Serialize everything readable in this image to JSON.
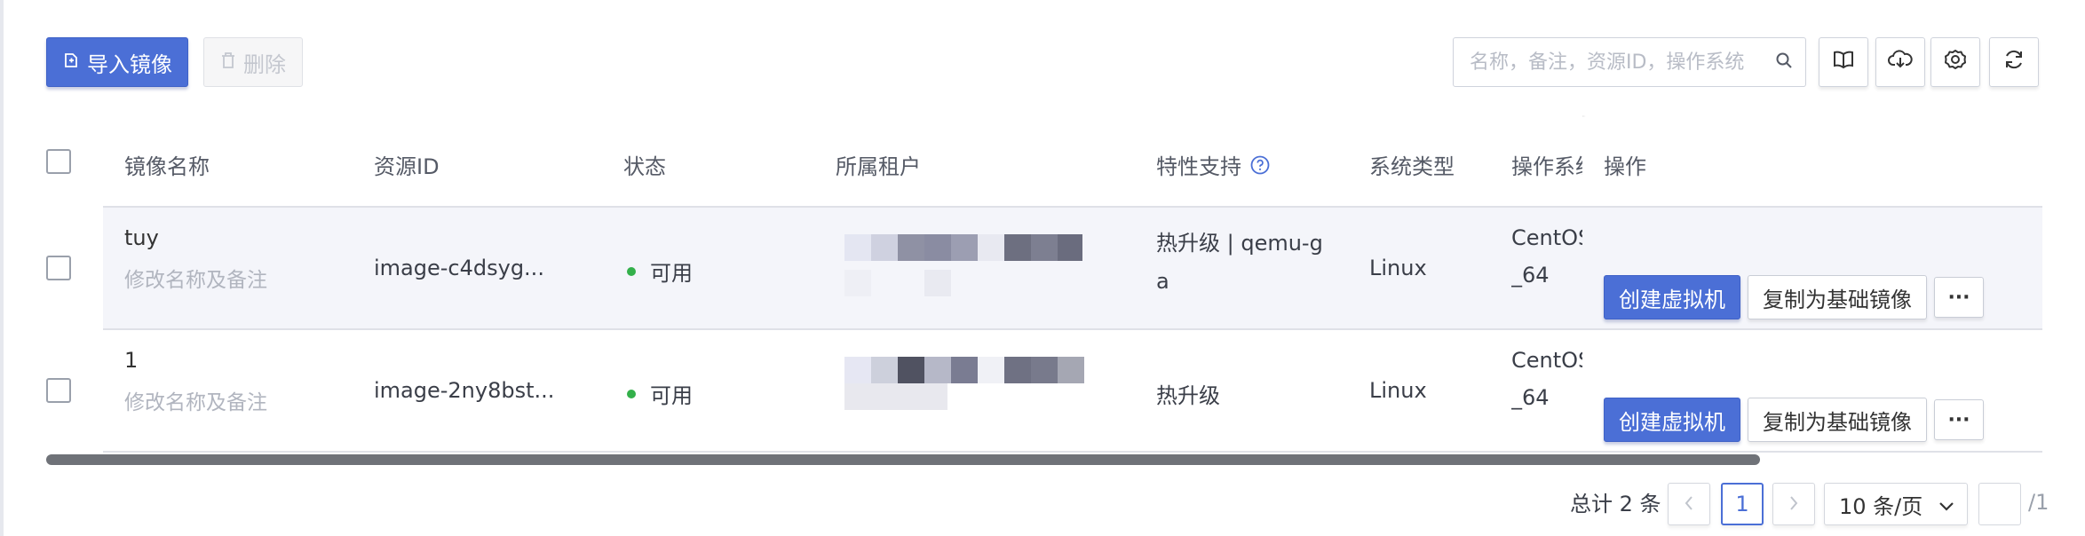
{
  "toolbar": {
    "import_label": "导入镜像",
    "delete_label": "删除",
    "search_placeholder": "名称，备注，资源ID，操作系统"
  },
  "table": {
    "headers": {
      "name": "镜像名称",
      "resource_id": "资源ID",
      "status": "状态",
      "tenant": "所属租户",
      "features": "特性支持",
      "system_type": "系统类型",
      "os": "操作系统",
      "actions": "操作"
    },
    "rows": [
      {
        "name": "tuy",
        "note_action": "修改名称及备注",
        "resource_id": "image-c4dsyg...",
        "status": "可用",
        "features_line1": "热升级 | qemu-g",
        "features_line2": "a",
        "system_type": "Linux",
        "os_line1": "CentOS",
        "os_line2": "_64",
        "create_vm": "创建虚拟机",
        "copy_base": "复制为基础镜像",
        "more": "···"
      },
      {
        "name": "1",
        "note_action": "修改名称及备注",
        "resource_id": "image-2ny8bst...",
        "status": "可用",
        "features_line1": "热升级",
        "features_line2": "",
        "system_type": "Linux",
        "os_line1": "CentOS",
        "os_line2": "_64",
        "create_vm": "创建虚拟机",
        "copy_base": "复制为基础镜像",
        "more": "···"
      }
    ]
  },
  "pagination": {
    "total": "总计 2 条",
    "current_page": "1",
    "page_size": "10 条/页",
    "page_suffix": "/1"
  },
  "colors": {
    "primary": "#4b6fd6",
    "status_available": "#33b04a",
    "row_background": "#f4f5fa"
  },
  "icons": {
    "import": "import-icon",
    "delete": "trash-icon",
    "search": "search-icon",
    "docs": "book-icon",
    "download": "cloud-download-icon",
    "settings": "gear-icon",
    "refresh": "refresh-icon",
    "help": "help-circle-icon"
  }
}
